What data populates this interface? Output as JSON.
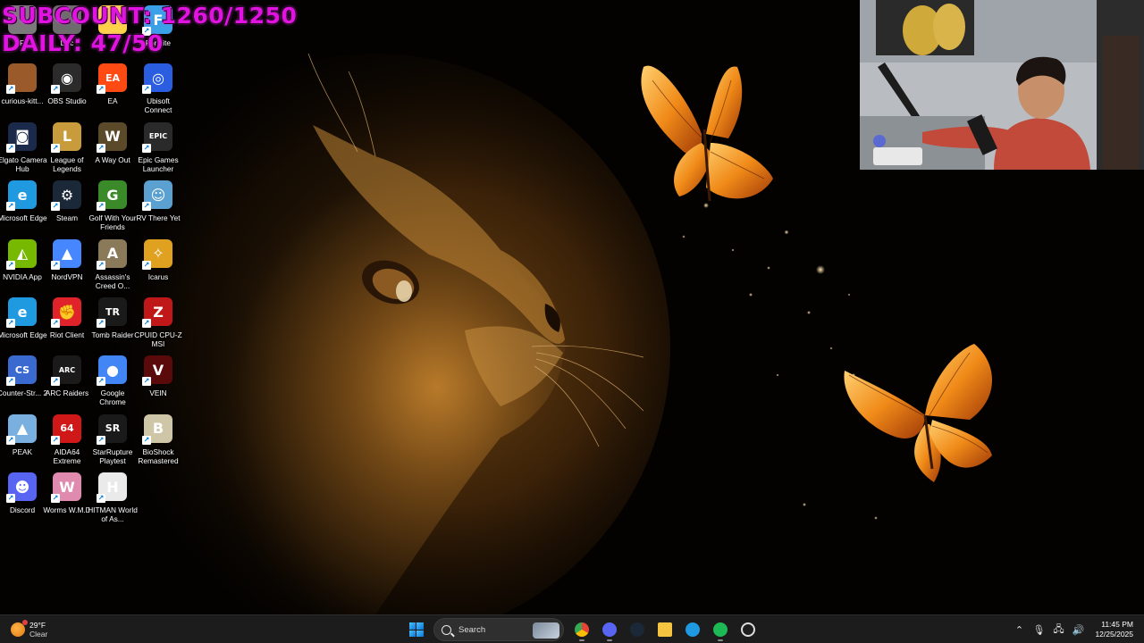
{
  "overlay": {
    "subcount": "SUBCOUNT: 1260/1250",
    "daily": "DAILY: 47/50"
  },
  "desktop": {
    "icons": [
      {
        "label": "R",
        "icon": "partial-icon",
        "color": "#7a7a7a"
      },
      {
        "label": "Dec",
        "icon": "partial-icon",
        "color": "#6c6c6c"
      },
      {
        "label": "",
        "icon": "partial-icon",
        "color": "#ffd24a"
      },
      {
        "label": "Fortnite",
        "icon": "fortnite-icon",
        "color": "#3aa0e8"
      },
      {
        "label": "curious-kitt...",
        "icon": "image-file-icon",
        "color": "#9a5a2a"
      },
      {
        "label": "OBS Studio",
        "icon": "obs-icon",
        "color": "#2b2b2b"
      },
      {
        "label": "EA",
        "icon": "ea-icon",
        "color": "#ff4a14"
      },
      {
        "label": "Ubisoft Connect",
        "icon": "ubisoft-icon",
        "color": "#2a5de0"
      },
      {
        "label": "Elgato Camera Hub",
        "icon": "elgato-camera-icon",
        "color": "#1b2a4a"
      },
      {
        "label": "League of Legends",
        "icon": "league-of-legends-icon",
        "color": "#c89b3c"
      },
      {
        "label": "A Way Out",
        "icon": "a-way-out-icon",
        "color": "#5a4a2a"
      },
      {
        "label": "Epic Games Launcher",
        "icon": "epic-games-icon",
        "color": "#2a2a2a"
      },
      {
        "label": "Microsoft Edge",
        "icon": "edge-icon",
        "color": "#1f9ae0"
      },
      {
        "label": "Steam",
        "icon": "steam-icon",
        "color": "#1b2838"
      },
      {
        "label": "Golf With Your Friends",
        "icon": "golf-icon",
        "color": "#3a8a2a"
      },
      {
        "label": "RV There Yet",
        "icon": "rv-there-yet-icon",
        "color": "#5aa0d0"
      },
      {
        "label": "NVIDIA App",
        "icon": "nvidia-icon",
        "color": "#76b900"
      },
      {
        "label": "NordVPN",
        "icon": "nordvpn-icon",
        "color": "#4687ff"
      },
      {
        "label": "Assassin's Creed O...",
        "icon": "assassins-creed-icon",
        "color": "#8a7a5a"
      },
      {
        "label": "Icarus",
        "icon": "icarus-icon",
        "color": "#e0a020"
      },
      {
        "label": "Microsoft Edge",
        "icon": "edge-icon",
        "color": "#1f9ae0"
      },
      {
        "label": "Riot Client",
        "icon": "riot-client-icon",
        "color": "#e0222a"
      },
      {
        "label": "Tomb Raider",
        "icon": "tomb-raider-icon",
        "color": "#1a1a1a"
      },
      {
        "label": "CPUID CPU-Z MSI",
        "icon": "cpuz-icon",
        "color": "#c01818"
      },
      {
        "label": "Counter-Str... 2",
        "icon": "counter-strike-icon",
        "color": "#3a6ad0"
      },
      {
        "label": "ARC Raiders",
        "icon": "arc-raiders-icon",
        "color": "#1a1a1a"
      },
      {
        "label": "Google Chrome",
        "icon": "chrome-icon",
        "color": "#4285f4"
      },
      {
        "label": "VEIN",
        "icon": "vein-icon",
        "color": "#5a0a0a"
      },
      {
        "label": "PEAK",
        "icon": "peak-icon",
        "color": "#7ab0e0"
      },
      {
        "label": "AIDA64 Extreme",
        "icon": "aida64-icon",
        "color": "#d01818"
      },
      {
        "label": "StarRupture Playtest",
        "icon": "starrupture-icon",
        "color": "#1a1a1a"
      },
      {
        "label": "BioShock Remastered",
        "icon": "bioshock-icon",
        "color": "#cfc6a8"
      },
      {
        "label": "Discord",
        "icon": "discord-icon",
        "color": "#5865f2"
      },
      {
        "label": "Worms W.M.D",
        "icon": "worms-icon",
        "color": "#e08ab0"
      },
      {
        "label": "HITMAN World of As...",
        "icon": "hitman-icon",
        "color": "#eaeaea"
      }
    ]
  },
  "taskbar": {
    "weather": {
      "temp": "29°F",
      "condition": "Clear"
    },
    "search_placeholder": "Search",
    "apps": [
      {
        "name": "chrome",
        "color": "#4285f4"
      },
      {
        "name": "discord",
        "color": "#5865f2"
      },
      {
        "name": "steam",
        "color": "#1b2838"
      },
      {
        "name": "file-explorer",
        "color": "#f5c542"
      },
      {
        "name": "edge",
        "color": "#1f9ae0"
      },
      {
        "name": "spotify",
        "color": "#1db954"
      },
      {
        "name": "obs",
        "color": "#2b2b2b"
      }
    ],
    "clock": {
      "time": "11:45 PM",
      "date": "12/25/2025"
    }
  }
}
